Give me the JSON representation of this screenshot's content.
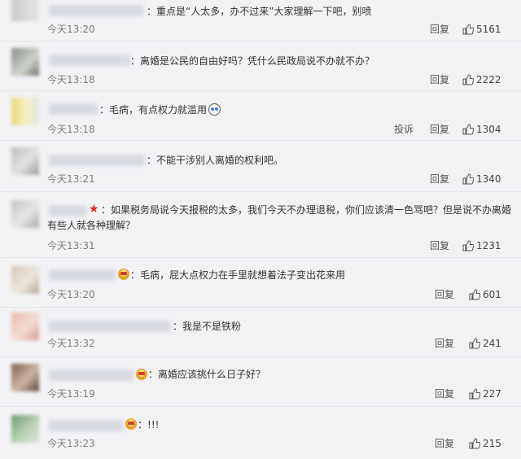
{
  "actions": {
    "reply": "回复",
    "report": "投诉"
  },
  "comments": [
    {
      "text": "重点是“人太多，办不过来”大家理解一下吧，别喷",
      "time": "今天13:20",
      "likes": "5161"
    },
    {
      "text": "离婚是公民的自由好吗？凭什么民政局说不办就不办？",
      "time": "今天13:18",
      "likes": "2222"
    },
    {
      "text": "毛病，有点权力就滥用",
      "time": "今天13:18",
      "likes": "1304"
    },
    {
      "text": "不能干涉别人离婚的权利吧。",
      "time": "今天13:21",
      "likes": "1340"
    },
    {
      "text_line1": "如果税务局说今天报税的太多，我们今天不办理退税，你们应该清一色骂吧？但是说不办离婚",
      "text_line2": "有些人就各种理解？",
      "time": "今天13:31",
      "likes": "1231"
    },
    {
      "text": "毛病，屁大点权力在手里就想着法子变出花来用",
      "time": "今天13:20",
      "likes": "601"
    },
    {
      "text": "我是不是铁粉",
      "time": "今天13:32",
      "likes": "241"
    },
    {
      "text": "离婚应该挑什么日子好？",
      "time": "今天13:19",
      "likes": "227"
    },
    {
      "text": "!!!",
      "time": "今天13:23",
      "likes": "215"
    }
  ],
  "icons": {
    "like": "thumbs-up-icon",
    "badge": "fan-badge-icon",
    "star": "star-icon",
    "emoji": "shocked-emoji-icon"
  },
  "colors": {
    "background": "#f2f2f5",
    "time": "#808080",
    "star": "#e5262b"
  }
}
